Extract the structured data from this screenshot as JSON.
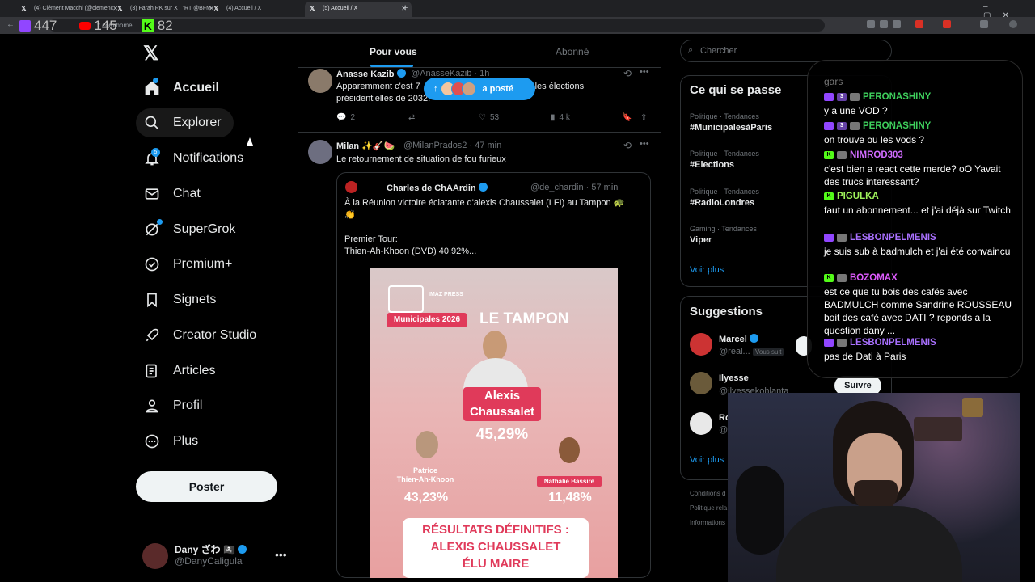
{
  "browser": {
    "tabs": [
      {
        "label": "(4) Clément Macchi (@clemenc"
      },
      {
        "label": "(3) Farah RK sur X : \"RT @BFM"
      },
      {
        "label": "(4) Accueil / X"
      },
      {
        "label": "(5) Accueil / X"
      }
    ],
    "address": "x.com/home"
  },
  "stream_stats": {
    "twitch": "447",
    "youtube": "145",
    "kick": "82"
  },
  "nav": {
    "items": [
      {
        "label": "Accueil"
      },
      {
        "label": "Explorer"
      },
      {
        "label": "Notifications"
      },
      {
        "label": "Chat"
      },
      {
        "label": "SuperGrok"
      },
      {
        "label": "Premium+"
      },
      {
        "label": "Signets"
      },
      {
        "label": "Creator Studio"
      },
      {
        "label": "Articles"
      },
      {
        "label": "Profil"
      },
      {
        "label": "Plus"
      }
    ],
    "notif_count": "5",
    "post_label": "Poster",
    "user": {
      "name": "Dany ざわ 🏴‍☠️",
      "handle": "@DanyCaligula"
    }
  },
  "feed": {
    "tabs": [
      {
        "label": "Pour vous"
      },
      {
        "label": "Abonné"
      }
    ],
    "new_posts_pill": "a posté",
    "tweet1": {
      "name": "Anasse Kazib",
      "handle": "@AnasseKazib · 1h",
      "text_a": "Apparemment c'est 7",
      "text_b": "les élections",
      "text_c": "présidentielles de 2032.",
      "replies": "2",
      "likes": "53",
      "views": "4 k"
    },
    "tweet2": {
      "name": "Milan ✨🎸🍉",
      "handle": "@MilanPrados2 · 47 min",
      "text": "Le retournement de situation de fou furieux",
      "quote": {
        "name": "Charles de ChAArdin",
        "handle": "@de_chardin · 57 min",
        "line1": "À la Réunion victoire éclatante d'alexis Chaussalet (LFI) au Tampon 🐢",
        "line2": "👏",
        "line3": "Premier Tour:",
        "line4": "Thien-Ah-Khoon (DVD) 40.92%..."
      },
      "poster": {
        "brand": "IMAZ PRESS",
        "badge": "Municipales 2026",
        "city": "LE TAMPON",
        "winner_first": "Alexis",
        "winner_last": "Chaussalet",
        "winner_pct": "45,29%",
        "c2_first": "Patrice",
        "c2_last": "Thien-Ah-Khoon",
        "c2_pct": "43,23%",
        "c3_name": "Nathalie Bassire",
        "c3_pct": "11,48%",
        "banner1": "RÉSULTATS DÉFINITIFS :",
        "banner2": "ALEXIS CHAUSSALET",
        "banner3": "ÉLU MAIRE"
      }
    }
  },
  "right": {
    "search_placeholder": "Chercher",
    "trends_title": "Ce qui se passe",
    "trends": [
      {
        "category": "Politique · Tendances",
        "name": "#MunicipalesàParis"
      },
      {
        "category": "Politique · Tendances",
        "name": "#Elections"
      },
      {
        "category": "Politique · Tendances",
        "name": "#RadioLondres"
      },
      {
        "category": "Gaming · Tendances",
        "name": "Viper"
      }
    ],
    "show_more": "Voir plus",
    "suggestions_title": "Suggestions",
    "suggestions": [
      {
        "name": "Marcel",
        "handle": "@real...",
        "badge": "Vous suit"
      },
      {
        "name": "Ilyesse",
        "handle": "@ilyessekohlanta",
        "follow": "Suivre"
      },
      {
        "name": "Ro",
        "handle": "@"
      }
    ],
    "show_more2": "Voir plus",
    "footer": [
      "Conditions d",
      "Politique rela",
      "Informations"
    ]
  },
  "chat": {
    "top_fragment": "gars",
    "messages": [
      {
        "user": "PERONASHINY",
        "color": "#3ecf5c",
        "text": "y a une VOD ?"
      },
      {
        "user": "PERONASHINY",
        "color": "#3ecf5c",
        "text": "on trouve ou les vods ?"
      },
      {
        "user": "NIMROD303",
        "color": "#d06bff",
        "text": "c'est bien a react cette merde? oO Yavait des trucs interessant?"
      },
      {
        "user": "PIGULKA",
        "color": "#9ef25a",
        "text": "faut un abonnement... et j'ai déjà sur Twitch"
      },
      {
        "user": "LESBONPELMENIS",
        "color": "#a970ff",
        "text": "je suis sub à badmulch et j'ai été convaincu"
      },
      {
        "user": "BOZOMAX",
        "color": "#e05cff",
        "text": "est ce que tu bois des cafés avec BADMULCH comme Sandrine ROUSSEAU boit des café avec DATI ? reponds a la question dany ..."
      },
      {
        "user": "LESBONPELMENIS",
        "color": "#a970ff",
        "text": "pas de Dati à Paris"
      }
    ]
  }
}
